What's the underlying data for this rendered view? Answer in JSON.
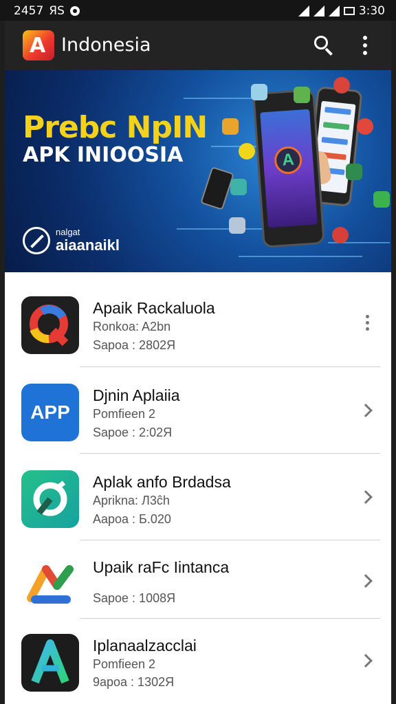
{
  "statusbar": {
    "time": "2457",
    "left_text": "ЯS",
    "clock": "3:30"
  },
  "appbar": {
    "title": "Indonesia",
    "logo_letter": "A",
    "search_icon": "search-icon",
    "menu_icon": "more-vert-icon"
  },
  "banner": {
    "title": "Prebc NpIN",
    "subtitle": "APK INIOOSIA",
    "brand_top": "nalgat",
    "brand_name": "aiaanaikl",
    "colors": {
      "title": "#f4d21c",
      "background": "#13509d"
    }
  },
  "apps": [
    {
      "name": "Apaik Rackaluola",
      "line1": "Ronkoa: A2bn",
      "line2": "Sapoa : 2802Я",
      "action_icon": "more-vert-icon"
    },
    {
      "name": "Djnin Aplaiia",
      "line1": "Pomfieen 2",
      "line2": "Sapoe : 2:02Я",
      "icon_text": "APP",
      "action_icon": "chevron-right-icon"
    },
    {
      "name": "Aplak anfo Brdadsa",
      "line1": "Aprikna: Л3ĉh",
      "line2": "Aapoa : Б.020",
      "action_icon": "chevron-right-icon"
    },
    {
      "name": "Upaik raFc Iintanca",
      "line1": "",
      "line2": "Sapoe : 1008Я",
      "action_icon": "chevron-right-icon"
    },
    {
      "name": "Iplanaalzacclai",
      "line1": "Pomfieen 2",
      "line2": "9apoa : 1302Я",
      "action_icon": "chevron-right-icon"
    }
  ]
}
